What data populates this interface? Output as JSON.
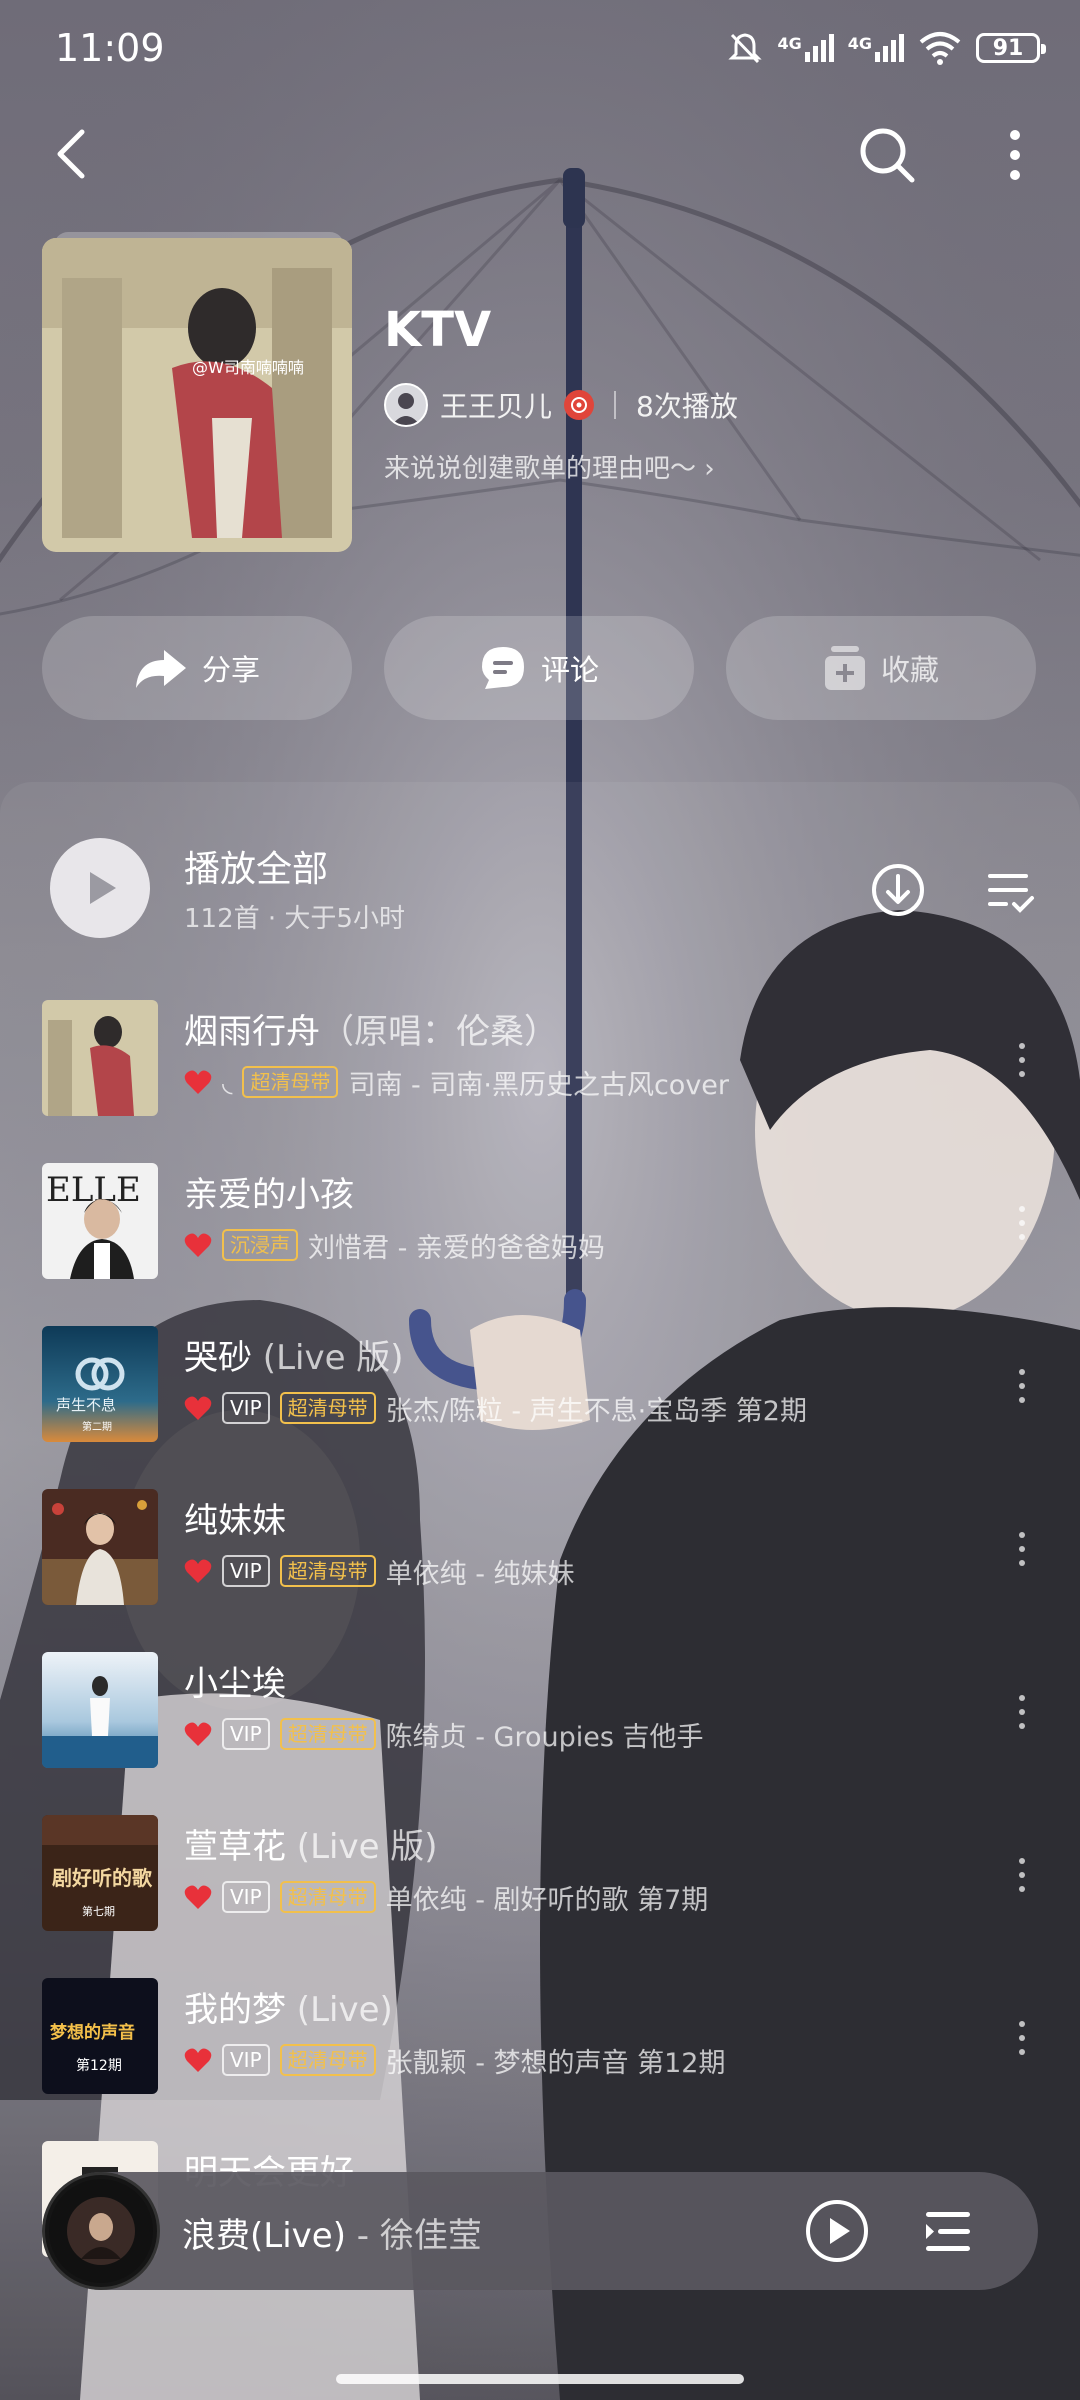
{
  "status": {
    "time": "11:09",
    "network1": "4G",
    "network2": "4G",
    "battery": "91"
  },
  "nav": {
    "back_icon": "back-icon",
    "search_icon": "search-icon",
    "more_icon": "more-icon"
  },
  "playlist": {
    "title": "KTV",
    "creator": "王王贝儿",
    "plays": "8次播放",
    "description": "来说说创建歌单的理由吧～ ›",
    "cover_watermark": "@W司南喃喃喃"
  },
  "actions": [
    {
      "label": "分享",
      "icon": "share-icon"
    },
    {
      "label": "评论",
      "icon": "comment-icon"
    },
    {
      "label": "收藏",
      "icon": "collect-icon"
    }
  ],
  "play_all": {
    "title": "播放全部",
    "subtitle": "112首 · 大于5小时"
  },
  "songs": [
    {
      "title": "烟雨行舟",
      "suffix": "（原唱：伦桑）",
      "liked": true,
      "tags": [
        "超清母带"
      ],
      "tag_prefix": "◟",
      "meta": "司南 - 司南·黑历史之古风cover"
    },
    {
      "title": "亲爱的小孩",
      "suffix": "",
      "liked": true,
      "tags": [
        "沉浸声"
      ],
      "meta": "刘惜君 - 亲爱的爸爸妈妈"
    },
    {
      "title": "哭砂",
      "suffix": " (Live 版)",
      "liked": true,
      "tags": [
        "VIP",
        "超清母带"
      ],
      "meta": "张杰/陈粒 - 声生不息·宝岛季 第2期"
    },
    {
      "title": "纯妹妹",
      "suffix": "",
      "liked": true,
      "tags": [
        "VIP",
        "超清母带"
      ],
      "meta": "单依纯 - 纯妹妹"
    },
    {
      "title": "小尘埃",
      "suffix": "",
      "liked": true,
      "tags": [
        "VIP",
        "超清母带"
      ],
      "meta": "陈绮贞 - Groupies 吉他手"
    },
    {
      "title": "萱草花",
      "suffix": " (Live 版)",
      "liked": true,
      "tags": [
        "VIP",
        "超清母带"
      ],
      "meta": "单依纯 - 剧好听的歌 第7期"
    },
    {
      "title": "我的梦",
      "suffix": " (Live)",
      "liked": true,
      "tags": [
        "VIP",
        "超清母带"
      ],
      "meta": "张靓颖 - 梦想的声音 第12期"
    },
    {
      "title": "明天会更好",
      "suffix": "",
      "liked": false,
      "tags": [],
      "meta": ""
    }
  ],
  "thumbs": {
    "elle": "ELLE",
    "shengsheng": "声生不息",
    "shengsheng_ep": "第二期",
    "juhaoting": "剧好听的歌",
    "juhaoting_ep": "第七期",
    "mengxiang": "梦想的声音",
    "mengxiang_ep": "第12期"
  },
  "mini_player": {
    "song": "浪费(Live)",
    "artist": " - 徐佳莹"
  },
  "colors": {
    "accent_red": "#e8313a",
    "gold_tag": "#f2c04c"
  }
}
